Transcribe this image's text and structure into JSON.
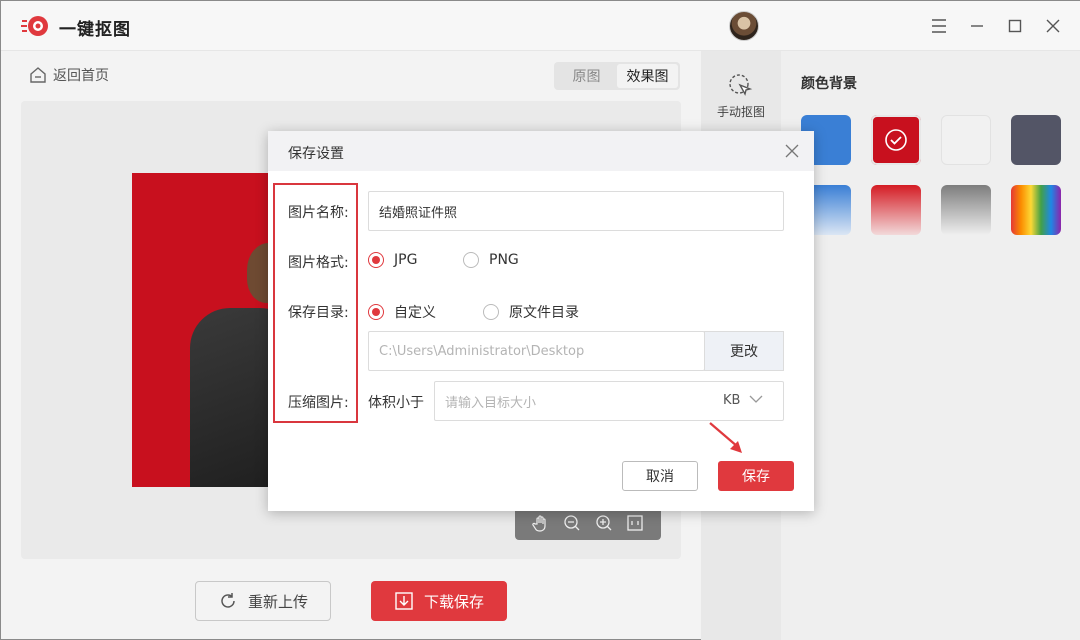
{
  "app": {
    "title": "一键抠图"
  },
  "window": {
    "icons": [
      "menu-icon",
      "minimize-icon",
      "maximize-icon",
      "close-icon"
    ]
  },
  "toolbar": {
    "back_home": "返回首页"
  },
  "view_tabs": [
    {
      "label": "原图",
      "active": false
    },
    {
      "label": "效果图",
      "active": true
    }
  ],
  "bottom_buttons": {
    "reupload": "重新上传",
    "download": "下载保存"
  },
  "side_tool": {
    "manual": "手动抠图"
  },
  "right_panel": {
    "title": "颜色背景",
    "swatches": [
      {
        "name": "blue",
        "color": "#3a7fd5",
        "selected": false
      },
      {
        "name": "red",
        "color": "#c8101e",
        "selected": true
      },
      {
        "name": "white",
        "color": "#f1f1f1",
        "selected": false
      },
      {
        "name": "dark-gray",
        "color": "#535566",
        "selected": false
      },
      {
        "name": "blue-gradient",
        "color": "#4a86d0",
        "selected": false
      },
      {
        "name": "red-gradient",
        "color": "#d41c24",
        "selected": false
      },
      {
        "name": "gray-gradient",
        "color": "#8a8a8a",
        "selected": false
      },
      {
        "name": "rainbow",
        "color": "rainbow",
        "selected": false
      }
    ]
  },
  "dialog": {
    "title": "保存设置",
    "name_label": "图片名称:",
    "name_value": "结婚照证件照",
    "format_label": "图片格式:",
    "formats": [
      {
        "label": "JPG",
        "selected": true
      },
      {
        "label": "PNG",
        "selected": false
      }
    ],
    "dir_label": "保存目录:",
    "dir_options": [
      {
        "label": "自定义",
        "selected": true
      },
      {
        "label": "原文件目录",
        "selected": false
      }
    ],
    "dir_path": "C:\\Users\\Administrator\\Desktop",
    "change_button": "更改",
    "compress_label": "压缩图片:",
    "compress_prefix": "体积小于",
    "compress_placeholder": "请输入目标大小",
    "compress_unit": "KB",
    "cancel_button": "取消",
    "save_button": "保存"
  },
  "colors": {
    "accent": "#e0393e"
  }
}
